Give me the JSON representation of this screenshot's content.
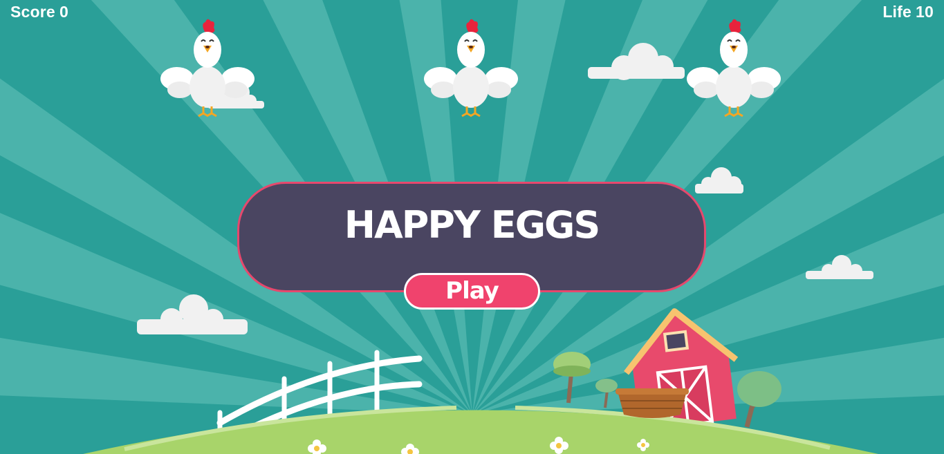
{
  "hud": {
    "score_label": "Score",
    "score_value": "0",
    "life_label": "Life",
    "life_value": "10"
  },
  "title": "HAPPY EGGS",
  "play_label": "Play",
  "colors": {
    "sky": "#2a9f98",
    "panel": "#4a4561",
    "accent": "#f0436d",
    "grass": "#a8d46a",
    "barn": "#e84a6c"
  },
  "icons": [
    "hen-icon",
    "cloud-icon",
    "barn-icon",
    "basket-icon",
    "tree-icon",
    "fence-icon",
    "flower-icon"
  ]
}
